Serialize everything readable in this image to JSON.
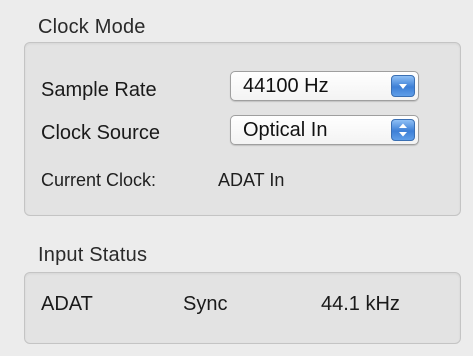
{
  "clock_mode": {
    "title": "Clock Mode",
    "sample_rate": {
      "label": "Sample Rate",
      "value": "44100 Hz",
      "icon": "chevron-down-icon"
    },
    "clock_source": {
      "label": "Clock Source",
      "value": "Optical In",
      "icon": "up-down-chevron-icon"
    },
    "current_clock": {
      "label": "Current Clock:",
      "value": "ADAT In"
    }
  },
  "input_status": {
    "title": "Input Status",
    "input": "ADAT",
    "state": "Sync",
    "rate": "44.1 kHz"
  },
  "colors": {
    "accent": "#4a8ae0",
    "panel": "#e3e3e3",
    "background": "#ececec"
  }
}
